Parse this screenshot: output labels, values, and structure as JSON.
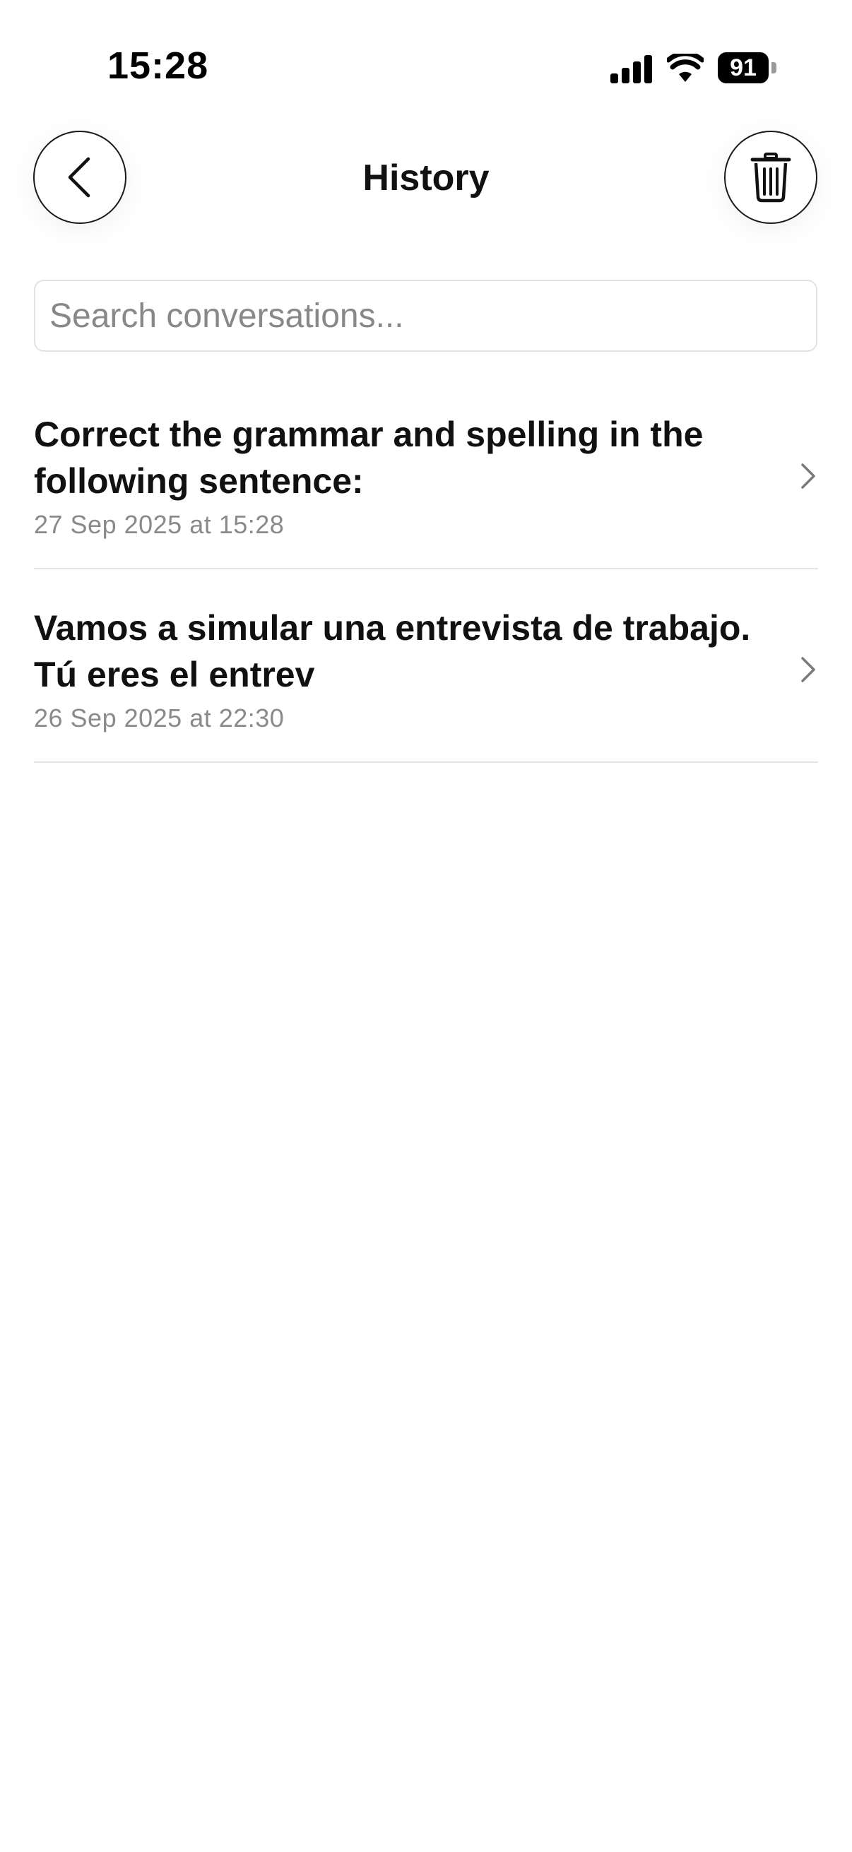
{
  "status_bar": {
    "time": "15:28",
    "battery_level": "91",
    "signal_icon": "cellular-signal-icon",
    "wifi_icon": "wifi-icon"
  },
  "header": {
    "title": "History",
    "back_icon": "chevron-left-icon",
    "delete_icon": "trash-icon"
  },
  "search": {
    "placeholder": "Search conversations...",
    "value": ""
  },
  "conversations": [
    {
      "title": "Correct the grammar and spelling in the following sentence:",
      "date": "27 Sep 2025 at 15:28"
    },
    {
      "title": "Vamos a simular una entrevista de trabajo. Tú eres el entrev",
      "date": "26 Sep 2025 at 22:30"
    }
  ],
  "colors": {
    "background": "#ffffff",
    "text_primary": "#111111",
    "text_secondary": "#8a8a8a",
    "divider": "#e4e4e4"
  }
}
